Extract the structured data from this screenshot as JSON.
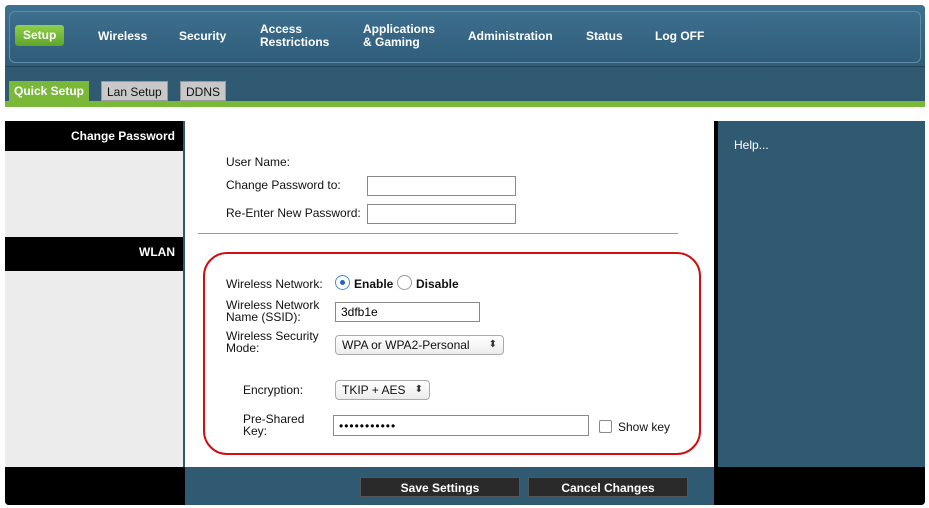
{
  "nav": {
    "items": [
      {
        "label": "Setup"
      },
      {
        "label": "Wireless"
      },
      {
        "label": "Security"
      },
      {
        "label": "Access\nRestrictions"
      },
      {
        "label": "Applications\n& Gaming"
      },
      {
        "label": "Administration"
      },
      {
        "label": "Status"
      },
      {
        "label": "Log OFF"
      }
    ]
  },
  "subtabs": {
    "quick_setup": "Quick Setup",
    "lan_setup": "Lan Setup",
    "ddns": "DDNS"
  },
  "sections": {
    "change_password": "Change Password",
    "wlan": "WLAN"
  },
  "help": {
    "label": "Help..."
  },
  "password": {
    "user_name_label": "User Name:",
    "change_label": "Change Password to:",
    "reenter_label": "Re-Enter New Password:",
    "change_value": "",
    "reenter_value": ""
  },
  "wlan": {
    "wireless_network_label": "Wireless Network:",
    "enable_label": "Enable",
    "disable_label": "Disable",
    "enabled": true,
    "ssid_label": "Wireless Network\nName (SSID):",
    "ssid_value": "3dfb1e",
    "security_mode_label": "Wireless Security\nMode:",
    "security_mode_value": "WPA or WPA2-Personal",
    "encryption_label": "Encryption:",
    "encryption_value": "TKIP + AES",
    "psk_label": "Pre-Shared\nKey:",
    "psk_value": "•••••••••••",
    "show_key_label": "Show key",
    "show_key_checked": false
  },
  "buttons": {
    "save": "Save Settings",
    "cancel": "Cancel Changes"
  },
  "colors": {
    "accent_green": "#7ab83a",
    "panel_blue": "#2f5a72",
    "highlight_red": "#d01010"
  }
}
